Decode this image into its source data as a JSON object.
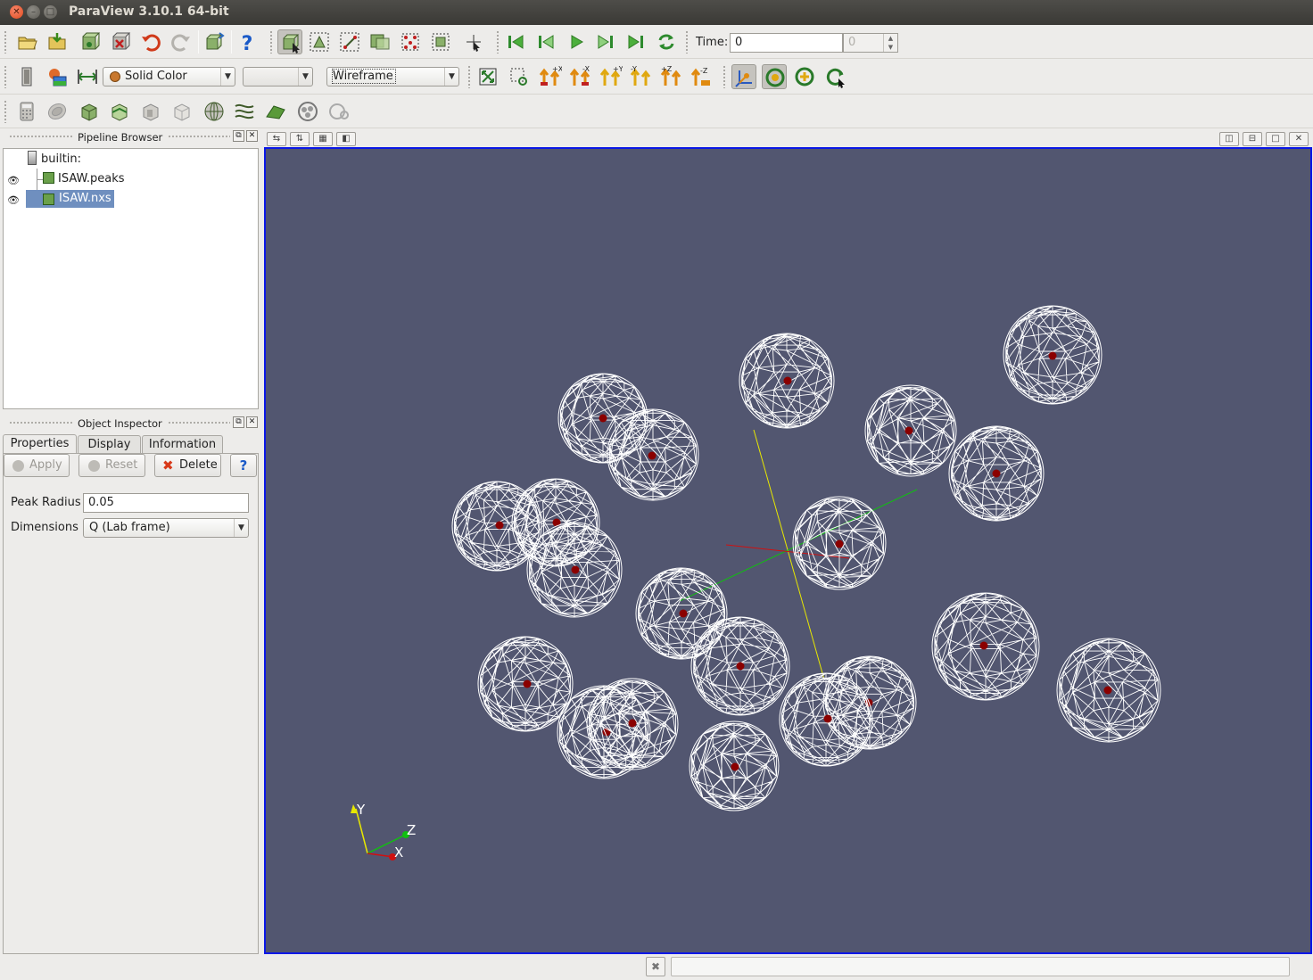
{
  "window": {
    "title": "ParaView 3.10.1 64-bit"
  },
  "toolbar_main": {
    "time_label": "Time:",
    "time_value": "0",
    "time_step_value": "0"
  },
  "toolbar_display": {
    "color_by": "Solid Color",
    "color_component": "",
    "representation": "Wireframe",
    "camera_axis_labels": [
      "+X",
      "-X",
      "+Y",
      "-Y",
      "+Z",
      "-Z"
    ]
  },
  "pipeline_browser": {
    "title": "Pipeline Browser",
    "root": "builtin:",
    "items": [
      {
        "label": "ISAW.peaks",
        "visible": true,
        "selected": false
      },
      {
        "label": "ISAW.nxs",
        "visible": true,
        "selected": true
      }
    ]
  },
  "object_inspector": {
    "title": "Object Inspector",
    "tabs": [
      "Properties",
      "Display",
      "Information"
    ],
    "active_tab": "Properties",
    "buttons": {
      "apply": "Apply",
      "reset": "Reset",
      "delete": "Delete",
      "help": "?"
    },
    "fields": {
      "peak_radius_label": "Peak Radius",
      "peak_radius_value": "0.05",
      "dimensions_label": "Dimensions",
      "dimensions_value": "Q (Lab frame)"
    }
  },
  "render_view": {
    "background_color": "#525670",
    "active_border_color": "#0b18e6",
    "orientation_axes": {
      "x": "X",
      "y": "Y",
      "z": "Z"
    },
    "peak_count": 23
  },
  "colors": {
    "wireframe": "#ffffff",
    "peak_center": "#8b0000",
    "axis_x": "#d01010",
    "axis_y": "#e8e800",
    "axis_z": "#10c010"
  }
}
